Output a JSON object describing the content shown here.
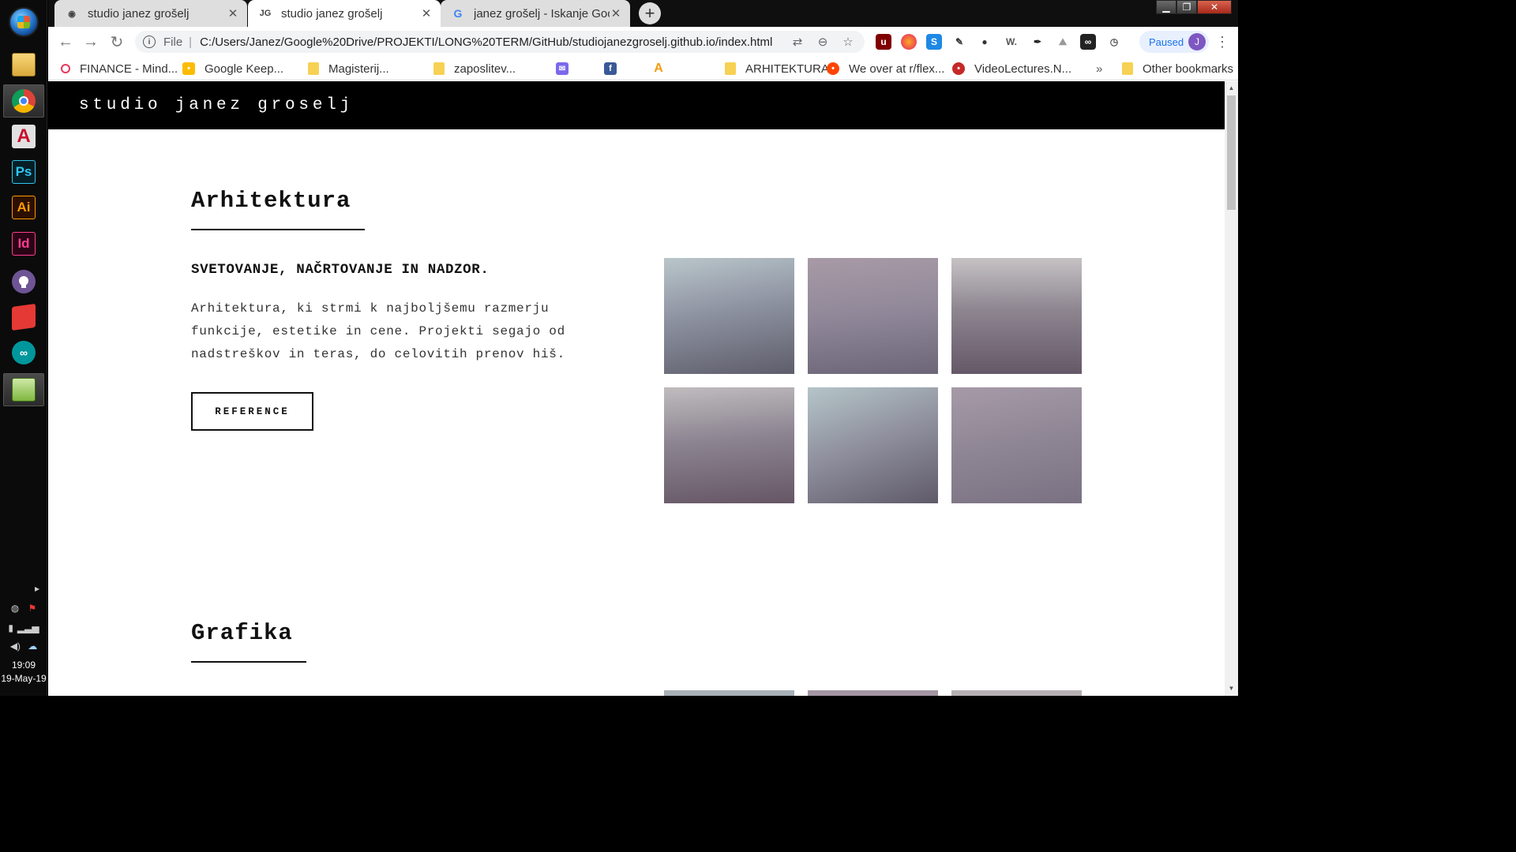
{
  "taskbar": {
    "apps": [
      {
        "name": "file-explorer"
      },
      {
        "name": "chrome"
      },
      {
        "name": "autocad",
        "glyph": "A"
      },
      {
        "name": "photoshop",
        "glyph": "Ps"
      },
      {
        "name": "illustrator",
        "glyph": "Ai"
      },
      {
        "name": "indesign",
        "glyph": "Id"
      },
      {
        "name": "github-desktop"
      },
      {
        "name": "sketchup"
      },
      {
        "name": "arduino"
      },
      {
        "name": "notepad"
      }
    ],
    "time": "19:09",
    "date": "19-May-19"
  },
  "browser": {
    "tabs": [
      {
        "title": "studio janez grošelj",
        "active": false
      },
      {
        "title": "studio janez grošelj",
        "favicon_text": "JG",
        "active": true
      },
      {
        "title": "janez grošelj - Iskanje Google",
        "active": false
      }
    ],
    "omnibox": {
      "scheme": "File",
      "url": "C:/Users/Janez/Google%20Drive/PROJEKTI/LONG%20TERM/GitHub/studiojanezgroselj.github.io/index.html"
    },
    "profile": {
      "status": "Paused",
      "initial": "J"
    },
    "bookmarks": [
      {
        "label": "FINANCE - Mind..."
      },
      {
        "label": "Google Keep..."
      },
      {
        "label": "Magisterij..."
      },
      {
        "label": "zaposlitev..."
      },
      {
        "label": ""
      },
      {
        "label": ""
      },
      {
        "label": ""
      },
      {
        "label": "ARHITEKTURA"
      },
      {
        "label": "We over at r/flex..."
      },
      {
        "label": "VideoLectures.N..."
      }
    ],
    "bookmarks_overflow": "»",
    "other_bookmarks": "Other bookmarks"
  },
  "page": {
    "logo": "studio janez groselj",
    "sections": [
      {
        "title": "Arhitektura",
        "subtitle": "SVETOVANJE, NAČRTOVANJE IN NADZOR.",
        "body_lines": [
          "Arhitektura, ki strmi k najboljšemu razmerju",
          "funkcije, estetike in cene. Projekti segajo od",
          "nadstreškov in teras, do celovitih prenov hiš."
        ],
        "button": "REFERENCE"
      },
      {
        "title": "Grafika"
      }
    ]
  },
  "colors": {
    "header_bg": "#000000",
    "accent": "#111111",
    "tab_bg": "#dedede"
  }
}
